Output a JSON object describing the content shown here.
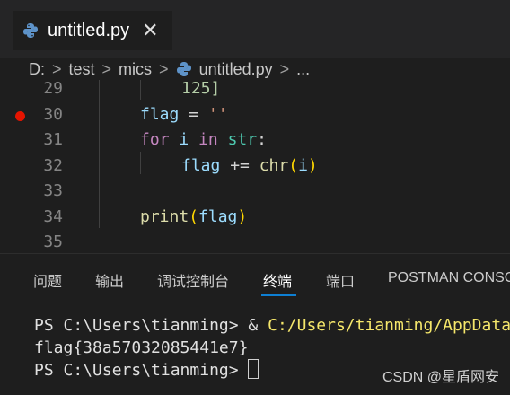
{
  "tab": {
    "title": "untitled.py",
    "close_glyph": "✕",
    "icon": "python-icon"
  },
  "breadcrumb": {
    "items": [
      "D:",
      "test",
      "mics",
      "untitled.py",
      "..."
    ],
    "separator": ">"
  },
  "editor": {
    "lines": [
      {
        "num": "29",
        "tokens": [
          [
            "125]",
            "#b5cea8"
          ]
        ],
        "indent": 2
      },
      {
        "num": "30",
        "tokens": [
          [
            "flag",
            "#9cdcfe"
          ],
          [
            " = ",
            "#d4d4d4"
          ],
          [
            "''",
            "#ce9178"
          ]
        ],
        "indent": 1,
        "breakpoint": true
      },
      {
        "num": "31",
        "tokens": [
          [
            "for",
            "#c586c0"
          ],
          [
            " ",
            "#d4d4d4"
          ],
          [
            "i",
            "#9cdcfe"
          ],
          [
            " ",
            "#d4d4d4"
          ],
          [
            "in",
            "#c586c0"
          ],
          [
            " ",
            "#d4d4d4"
          ],
          [
            "str",
            "#4ec9b0"
          ],
          [
            ":",
            "#d4d4d4"
          ]
        ],
        "indent": 1
      },
      {
        "num": "32",
        "tokens": [
          [
            "flag",
            "#9cdcfe"
          ],
          [
            " += ",
            "#d4d4d4"
          ],
          [
            "chr",
            "#dcdcaa"
          ],
          [
            "(",
            "#ffd700"
          ],
          [
            "i",
            "#9cdcfe"
          ],
          [
            ")",
            "#ffd700"
          ]
        ],
        "indent": 2
      },
      {
        "num": "33",
        "tokens": [],
        "indent": 1
      },
      {
        "num": "34",
        "tokens": [
          [
            "print",
            "#dcdcaa"
          ],
          [
            "(",
            "#ffd700"
          ],
          [
            "flag",
            "#9cdcfe"
          ],
          [
            ")",
            "#ffd700"
          ]
        ],
        "indent": 1
      },
      {
        "num": "35",
        "tokens": [],
        "indent": 0
      }
    ]
  },
  "panel": {
    "tabs": [
      "问题",
      "输出",
      "调试控制台",
      "终端",
      "端口",
      "POSTMAN CONSOLE"
    ],
    "active_tab": "终端",
    "terminal": {
      "line1_prompt": "PS C:\\Users\\tianming> ",
      "line1_amp": "& ",
      "line1_cmd": "C:/Users/tianming/AppData",
      "line2": "flag{38a57032085441e7}",
      "line3_prompt": "PS C:\\Users\\tianming> "
    }
  },
  "watermark": "CSDN @星盾网安",
  "colors": {
    "active_tab_underline": "#0e7fd3",
    "breakpoint": "#e51400",
    "terminal_cmd": "#f5e76b"
  }
}
